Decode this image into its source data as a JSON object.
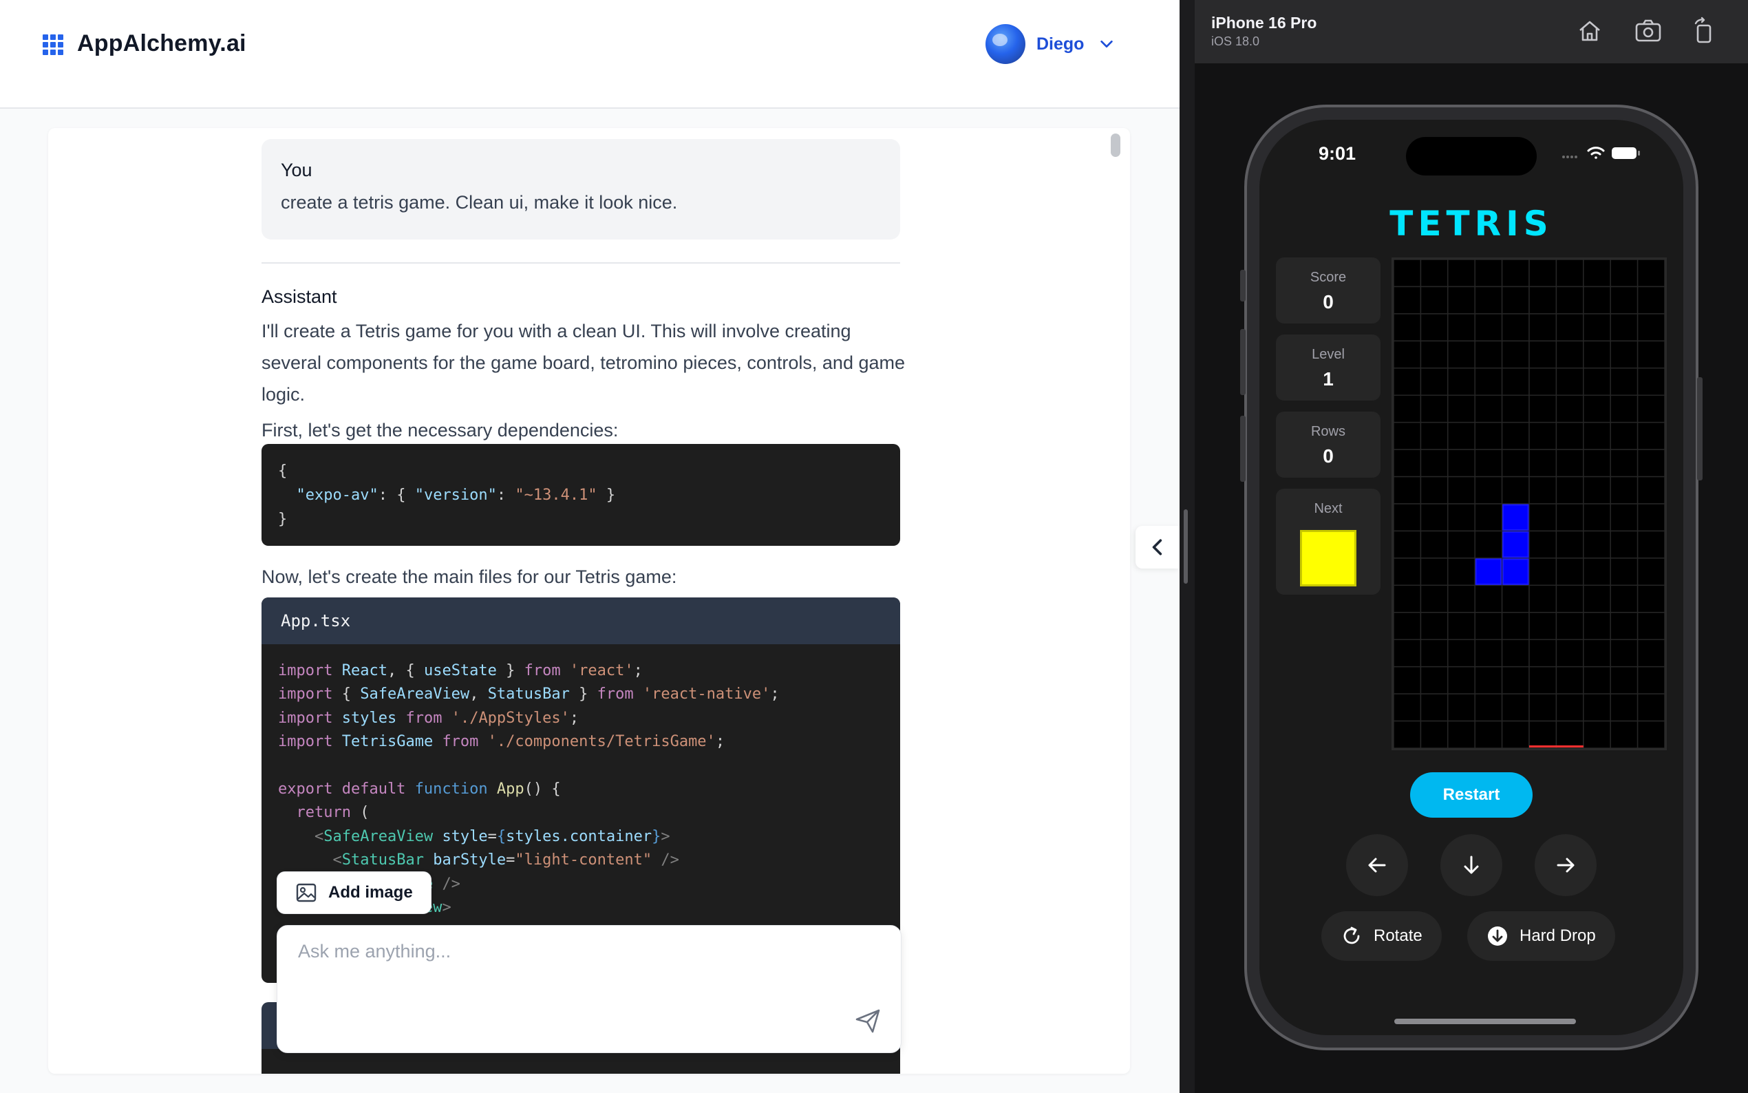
{
  "app": {
    "brand": "AppAlchemy.ai",
    "user_name": "Diego"
  },
  "chat": {
    "user_message": {
      "author": "You",
      "text": "create a tetris game. Clean ui, make it look nice."
    },
    "assistant_label": "Assistant",
    "assistant_intro": "I'll create a Tetris game for you with a clean UI. This will involve creating several components for the game board, tetromino pieces, controls, and game logic.",
    "assistant_deps": "First, let's get the necessary dependencies:",
    "deps_code": {
      "line1": "{",
      "key": "\"expo-av\"",
      "inner_key": "\"version\"",
      "inner_value": "\"~13.4.1\"",
      "line3": "}"
    },
    "assistant_files": "Now, let's create the main files for our Tetris game:",
    "file_name": "App.tsx",
    "add_image_label": "Add image",
    "input_placeholder": "Ask me anything..."
  },
  "simulator": {
    "device_name": "iPhone 16 Pro",
    "os_version": "iOS 18.0",
    "toolbar_icons": [
      "home-icon",
      "screenshot-icon",
      "rotate-device-icon"
    ],
    "status_time": "9:01"
  },
  "game": {
    "title": "TETRIS",
    "stats": [
      {
        "label": "Score",
        "value": "0"
      },
      {
        "label": "Level",
        "value": "1"
      },
      {
        "label": "Rows",
        "value": "0"
      }
    ],
    "next_label": "Next",
    "next_piece": "O",
    "board": {
      "cols": 10,
      "rows": 18,
      "active_piece": "J",
      "cells": [
        [
          4,
          9
        ],
        [
          4,
          10
        ],
        [
          4,
          11
        ],
        [
          3,
          11
        ]
      ]
    },
    "restart_label": "Restart",
    "rotate_label": "Rotate",
    "hard_drop_label": "Hard Drop",
    "colors": {
      "accent": "#00e5ff",
      "restart": "#00b8f0",
      "piece_active": "#0000ff",
      "piece_next": "#ffff00",
      "danger_line": "#ff3030"
    }
  }
}
